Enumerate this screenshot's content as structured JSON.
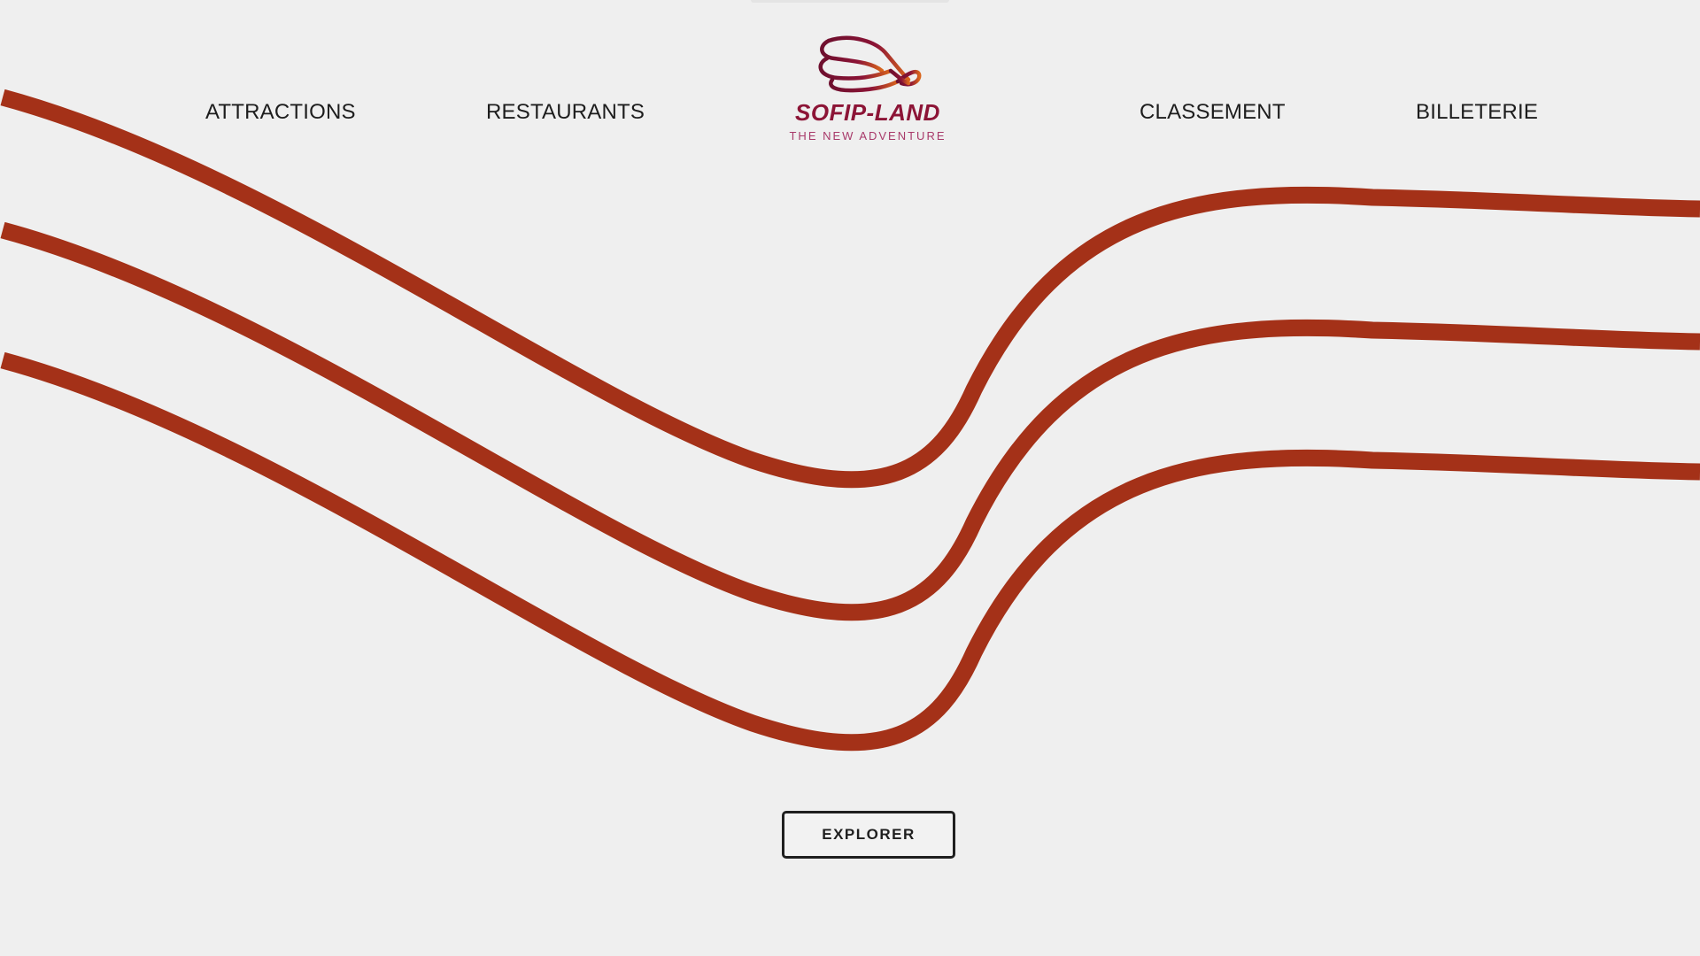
{
  "nav": {
    "attractions_label": "ATTRACTIONS",
    "restaurants_label": "RESTAURANTS",
    "classement_label": "CLASSEMENT",
    "billeterie_label": "BILLETERIE"
  },
  "logo": {
    "name": "SOFIP-LAND",
    "tagline": "THE NEW ADVENTURE",
    "icon": "roller-coaster-loop-icon"
  },
  "hero": {
    "explore_label": "EXPLORER",
    "decoration": "three-track-waves"
  },
  "colors": {
    "background": "#efefef",
    "track": "#a43118",
    "brand": "#8c1436",
    "brand_accent": "#d9651c",
    "tagline": "#a83a6a",
    "text": "#1d1d1d"
  }
}
